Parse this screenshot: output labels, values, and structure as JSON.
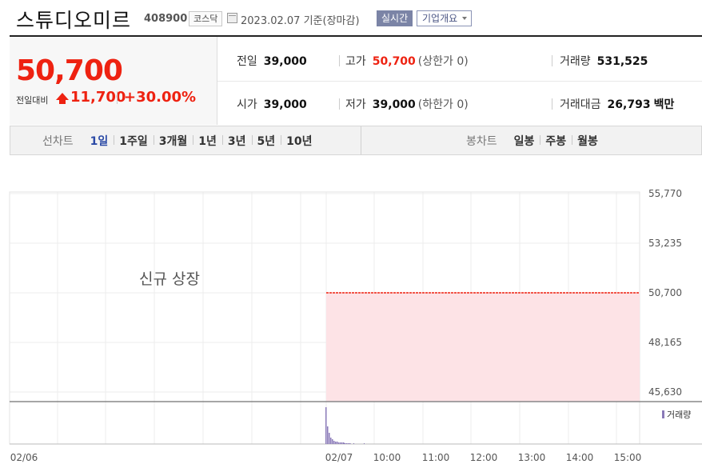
{
  "header": {
    "title": "스튜디오미르",
    "code": "408900",
    "market": "코스닥",
    "date": "2023.02.07",
    "basis": "기준(장마감)",
    "realtime_label": "실시간",
    "company_label": "기업개요"
  },
  "price": {
    "current": "50,700",
    "change_label": "전일대비",
    "change_amount": "11,700",
    "change_pct": "+30.00%"
  },
  "stats": {
    "prev_label": "전일",
    "prev_value": "39,000",
    "high_label": "고가",
    "high_value": "50,700",
    "high_note": "(상한가 0)",
    "volume_label": "거래량",
    "volume_value": "531,525",
    "open_label": "시가",
    "open_value": "39,000",
    "low_label": "저가",
    "low_value": "39,000",
    "low_note": "(하한가 0)",
    "amount_label": "거래대금",
    "amount_value": "26,793",
    "amount_unit": "백만"
  },
  "tabs": {
    "line_label": "선차트",
    "line_items": [
      "1일",
      "1주일",
      "3개월",
      "1년",
      "3년",
      "5년",
      "10년"
    ],
    "candle_label": "봉차트",
    "candle_items": [
      "일봉",
      "주봉",
      "월봉"
    ]
  },
  "colors": {
    "up": "#ee2211",
    "fill": "#fde3e6",
    "volume": "#8a7ab8",
    "active_tab": "#2b4aa6"
  },
  "chart_data": {
    "type": "area",
    "notice": "신규 상장",
    "volume_label": "거래량",
    "x_tick_labels": [
      "02/06",
      "02/07",
      "10:00",
      "11:00",
      "12:00",
      "13:00",
      "14:00",
      "15:00"
    ],
    "y_tick_labels": [
      "55,770",
      "53,235",
      "50,700",
      "48,165",
      "45,630"
    ],
    "ylim": [
      45630,
      55770
    ],
    "series": [
      {
        "x": [
          "09:00",
          "15:30"
        ],
        "values": [
          50700,
          50700
        ]
      }
    ],
    "grid": true
  }
}
